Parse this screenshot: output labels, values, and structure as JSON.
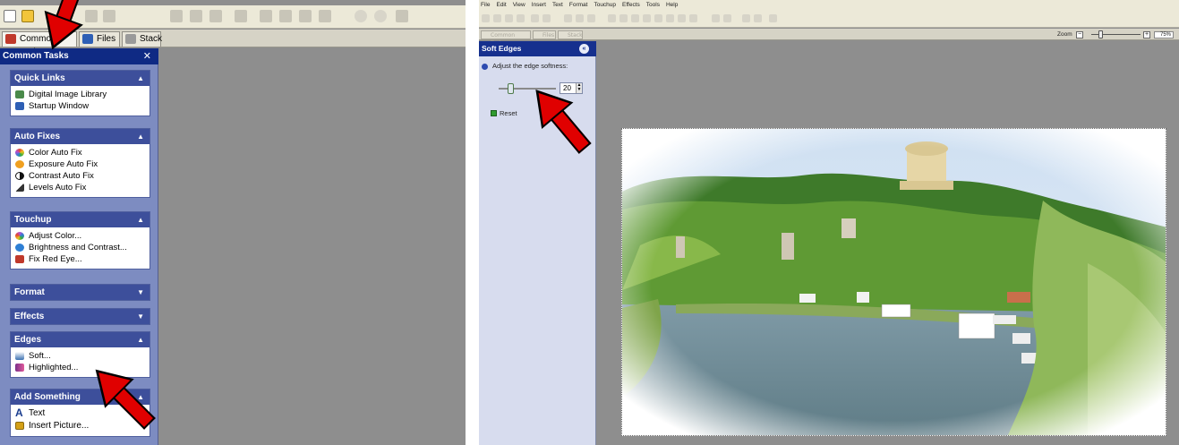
{
  "left_window": {
    "tabs": [
      {
        "label": "Common Tasks",
        "icon": "common-tasks-icon",
        "color": "#c0392b"
      },
      {
        "label": "Files",
        "icon": "files-icon",
        "color": "#2e5fb5"
      },
      {
        "label": "Stack",
        "icon": "stack-icon",
        "color": "#8a8a8a"
      }
    ],
    "pane": {
      "title": "Common Tasks",
      "close": "✕",
      "groups": [
        {
          "title": "Quick Links",
          "expanded": true,
          "items": [
            {
              "label": "Digital Image Library",
              "icon": "library-icon",
              "color": "#4a8a4a"
            },
            {
              "label": "Startup Window",
              "icon": "window-icon",
              "color": "#2e5fb5"
            }
          ]
        },
        {
          "title": "Auto Fixes",
          "expanded": true,
          "items": [
            {
              "label": "Color Auto Fix",
              "icon": "color-wheel-icon",
              "color": "#e34a2f"
            },
            {
              "label": "Exposure Auto Fix",
              "icon": "exposure-icon",
              "color": "#f0a020"
            },
            {
              "label": "Contrast Auto Fix",
              "icon": "contrast-icon",
              "color": "#111111"
            },
            {
              "label": "Levels Auto Fix",
              "icon": "levels-icon",
              "color": "#333333"
            }
          ]
        },
        {
          "title": "Touchup",
          "expanded": true,
          "items": [
            {
              "label": "Adjust Color...",
              "icon": "adjust-color-icon",
              "color": "#b64fd0"
            },
            {
              "label": "Brightness and Contrast...",
              "icon": "brightness-icon",
              "color": "#2e7fd5"
            },
            {
              "label": "Fix Red Eye...",
              "icon": "red-eye-icon",
              "color": "#c0392b"
            }
          ]
        },
        {
          "title": "Format",
          "expanded": false,
          "items": []
        },
        {
          "title": "Effects",
          "expanded": false,
          "items": []
        },
        {
          "title": "Edges",
          "expanded": true,
          "items": [
            {
              "label": "Soft...",
              "icon": "soft-edges-icon",
              "color": "#3a6fb0"
            },
            {
              "label": "Highlighted...",
              "icon": "highlighted-edges-icon",
              "color": "#7a2f8a"
            }
          ]
        },
        {
          "title": "Add Something",
          "expanded": true,
          "items": [
            {
              "label": "Text",
              "icon": "text-icon",
              "color": "#1a3d8f",
              "glyph": "A"
            },
            {
              "label": "Insert Picture...",
              "icon": "insert-picture-icon",
              "color": "#d4a017"
            }
          ]
        }
      ]
    }
  },
  "right_window": {
    "menu": [
      "File",
      "Edit",
      "View",
      "Insert",
      "Text",
      "Format",
      "Touchup",
      "Effects",
      "Tools",
      "Help"
    ],
    "tabs": [
      "Common Tasks",
      "Files",
      "Stack"
    ],
    "zoom": {
      "label": "Zoom",
      "minus": "−",
      "plus": "+",
      "value": "75%",
      "slider_fraction": 0.15
    },
    "pane": {
      "title": "Soft Edges",
      "close": "«",
      "instruction": "Adjust the edge softness:",
      "slider_value_fraction": 0.2,
      "spin_value": "20",
      "reset_label": "Reset"
    }
  },
  "colors": {
    "pane_blue": "#0f2a84",
    "group_header": "#3d4f9b",
    "arrow_red": "#e00000",
    "workspace_gray": "#8e8e8e"
  }
}
